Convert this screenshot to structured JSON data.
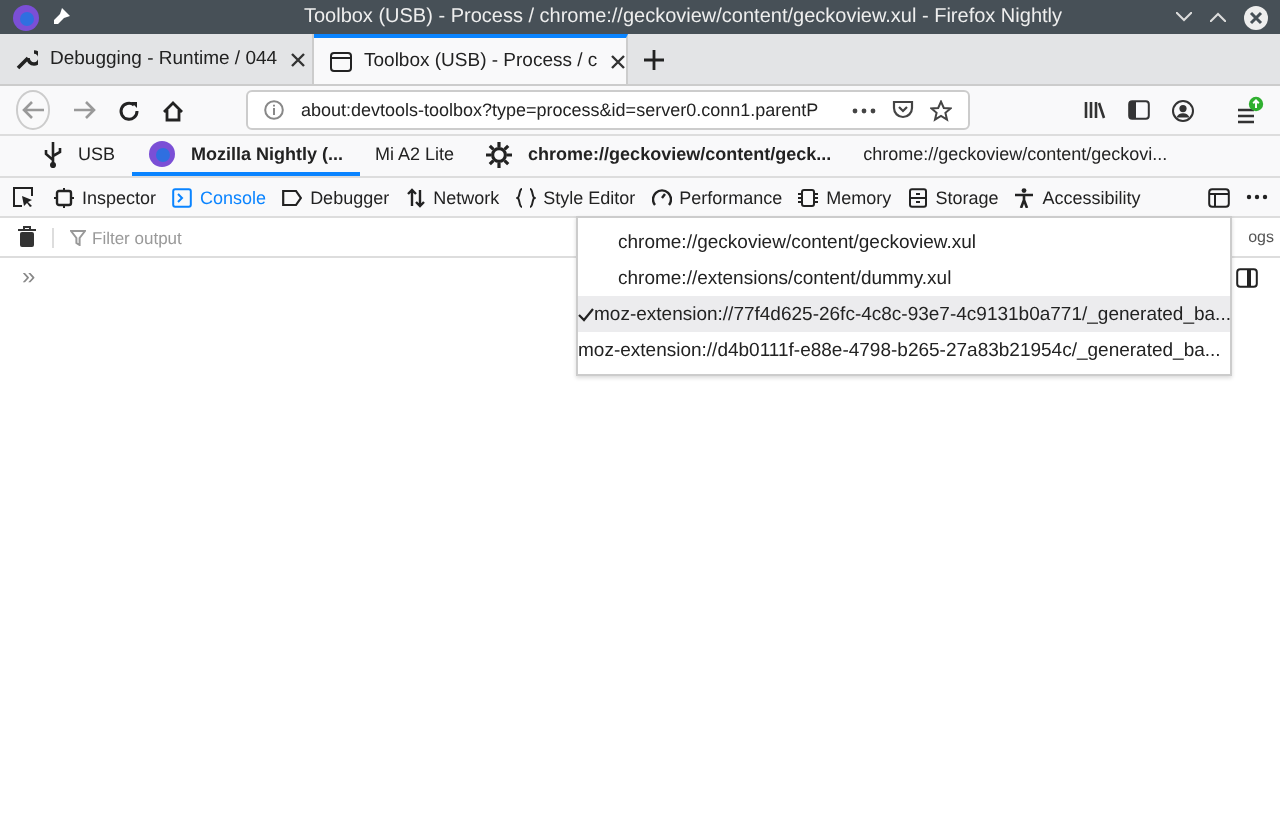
{
  "window": {
    "title": "Toolbox (USB) - Process / chrome://geckoview/content/geckoview.xul - Firefox Nightly"
  },
  "tabs": [
    {
      "label": "Debugging - Runtime / 044",
      "kind": "wrench",
      "selected": false
    },
    {
      "label": "Toolbox (USB) - Process / c",
      "kind": "page",
      "selected": true
    }
  ],
  "address_bar": {
    "value": "about:devtools-toolbox?type=process&id=server0.conn1.parentP"
  },
  "device_bar": [
    {
      "label": "USB",
      "kind": "usb",
      "bold": false,
      "selected": false
    },
    {
      "label": "Mozilla Nightly (...",
      "kind": "browser",
      "bold": true,
      "selected": true
    },
    {
      "label": "Mi A2 Lite",
      "kind": "text",
      "bold": false,
      "selected": false
    },
    {
      "label": "chrome://geckoview/content/geck...",
      "kind": "gear",
      "bold": true,
      "selected": false
    },
    {
      "label": "chrome://geckoview/content/geckovi...",
      "kind": "text",
      "bold": false,
      "selected": false
    }
  ],
  "devtools_tabs": [
    {
      "label": "Inspector",
      "kind": "inspector",
      "selected": false
    },
    {
      "label": "Console",
      "kind": "console",
      "selected": true
    },
    {
      "label": "Debugger",
      "kind": "debugger",
      "selected": false
    },
    {
      "label": "Network",
      "kind": "network",
      "selected": false
    },
    {
      "label": "Style Editor",
      "kind": "braces",
      "selected": false
    },
    {
      "label": "Performance",
      "kind": "performance",
      "selected": false
    },
    {
      "label": "Memory",
      "kind": "memory",
      "selected": false
    },
    {
      "label": "Storage",
      "kind": "storage",
      "selected": false
    },
    {
      "label": "Accessibility",
      "kind": "accessibility",
      "selected": false
    }
  ],
  "console": {
    "filter_placeholder": "Filter output",
    "option_fragment": "ogs",
    "prompt": "»"
  },
  "frame_menu": [
    {
      "label": "chrome://geckoview/content/geckoview.xul",
      "selected": false
    },
    {
      "label": "chrome://extensions/content/dummy.xul",
      "selected": false
    },
    {
      "label": "moz-extension://77f4d625-26fc-4c8c-93e7-4c9131b0a771/_generated_ba...",
      "selected": true
    },
    {
      "label": "moz-extension://d4b0111f-e88e-4798-b265-27a83b21954c/_generated_ba...",
      "selected": false
    }
  ]
}
